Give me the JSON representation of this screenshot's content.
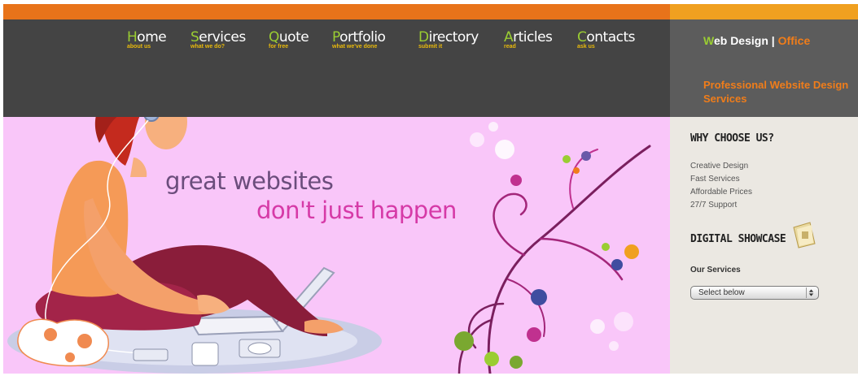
{
  "nav": {
    "items": [
      {
        "label": "Home",
        "sub": "about us"
      },
      {
        "label": "Services",
        "sub": "what we do?"
      },
      {
        "label": "Quote",
        "sub": "for free"
      },
      {
        "label": "Portfolio",
        "sub": "what we've done"
      },
      {
        "label": "Directory",
        "sub": "submit it"
      },
      {
        "label": "Articles",
        "sub": "read"
      },
      {
        "label": "Contacts",
        "sub": "ask us"
      }
    ]
  },
  "brand": {
    "first_letter": "W",
    "rest": "eb Design",
    "separator": "|",
    "office": "Office",
    "tagline": "Professional Website Design Services"
  },
  "hero": {
    "line1": "great websites",
    "line2": "don't just happen"
  },
  "sidebar": {
    "why_heading": "WHY CHOOSE US?",
    "reasons": [
      "Creative Design",
      "Fast Services",
      "Affordable Prices",
      "27/7 Support"
    ],
    "showcase_heading": "DIGITAL SHOWCASE",
    "services_label": "Our Services",
    "services_select": "Select below"
  },
  "colors": {
    "top_bar_left": "#e8731a",
    "top_bar_right": "#f0a020",
    "nav_bg": "#444444",
    "brand_bg": "#5c5c5c",
    "hero_bg": "#f9c6f9",
    "sidebar_bg": "#ebe8e2",
    "accent_green": "#9acd32",
    "accent_orange": "#f07d1a",
    "headline_purple": "#6b4d7c",
    "headline_pink": "#d63aa7"
  },
  "icons": {
    "showcase": "folder-icon",
    "select": "updown-arrows-icon"
  }
}
